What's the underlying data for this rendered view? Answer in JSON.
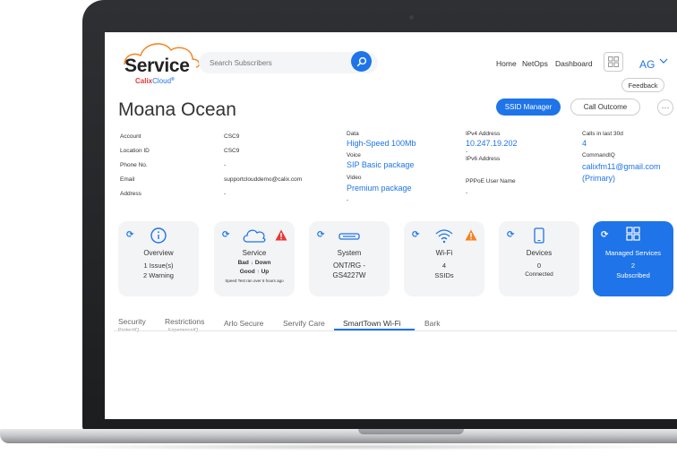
{
  "app": {
    "logo_text": "Service",
    "logo_brand": "Calix",
    "logo_brand_suffix": "Cloud",
    "search_placeholder": "Search Subscribers"
  },
  "nav": {
    "items": [
      "Home",
      "NetOps",
      "Dashboard"
    ],
    "user_initials": "AG",
    "feedback_label": "Feedback"
  },
  "subscriber": {
    "name": "Moana Ocean",
    "ssid_manager_label": "SSID Manager",
    "call_outcome_label": "Call Outcome",
    "more_label": "···"
  },
  "info": {
    "col1": [
      {
        "label": "Account",
        "value": "CSC9"
      },
      {
        "label": "Location ID",
        "value": "CSC9"
      },
      {
        "label": "Phone No.",
        "value": "-"
      },
      {
        "label": "Email",
        "value": "supportclouddemo@calix.com"
      },
      {
        "label": "Address",
        "value": "-"
      }
    ],
    "services": [
      {
        "label": "Data",
        "value": "High-Speed 100Mb"
      },
      {
        "label": "Voice",
        "value": "SIP Basic package"
      },
      {
        "label": "Video",
        "value": "Premium package"
      }
    ],
    "network": {
      "ipv4_label": "IPv4 Address",
      "ipv4_value": "10.247.19.202",
      "ipv4_sub": "-",
      "ipv6_label": "IPv6 Address",
      "pppoe_label": "PPPoE User Name",
      "pppoe_value": "-"
    },
    "calls": {
      "calls_label": "Calls in last 30d",
      "calls_value": "4",
      "commandiq_label": "CommandIQ",
      "commandiq_email": "calixfm11@gmail.com",
      "commandiq_primary": "(Primary)"
    }
  },
  "cards": {
    "overview": {
      "title": "Overview",
      "line1": "1 Issue(s)",
      "line2": "2 Warning"
    },
    "service": {
      "title": "Service",
      "bad_label": "Bad",
      "down_label": "Down",
      "good_label": "Good",
      "up_label": "Up",
      "note": "Speed Test ran over 6 hours ago"
    },
    "system": {
      "title": "System",
      "line1": "ONT/RG -",
      "line2": "GS4227W"
    },
    "wifi": {
      "title": "Wi-Fi",
      "line1": "4",
      "line2": "SSIDs"
    },
    "devices": {
      "title": "Devices",
      "line1": "0",
      "line2": "Connected"
    },
    "managed": {
      "title": "Managed Services",
      "line1": "2",
      "line2": "Subscribed"
    }
  },
  "tabs": [
    {
      "label": "Security",
      "sub": "ProtectIQ"
    },
    {
      "label": "Restrictions",
      "sub": "ExperienceIQ"
    },
    {
      "label": "Arlo Secure",
      "sub": ""
    },
    {
      "label": "Servify Care",
      "sub": ""
    },
    {
      "label": "SmartTown Wi-Fi",
      "sub": ""
    },
    {
      "label": "Bark",
      "sub": ""
    }
  ],
  "active_tab": "SmartTown Wi-Fi",
  "colors": {
    "accent": "#1e74e8",
    "warning_orange": "#f5821f",
    "error_red": "#e53935",
    "bezel": "#1c1d1f"
  }
}
